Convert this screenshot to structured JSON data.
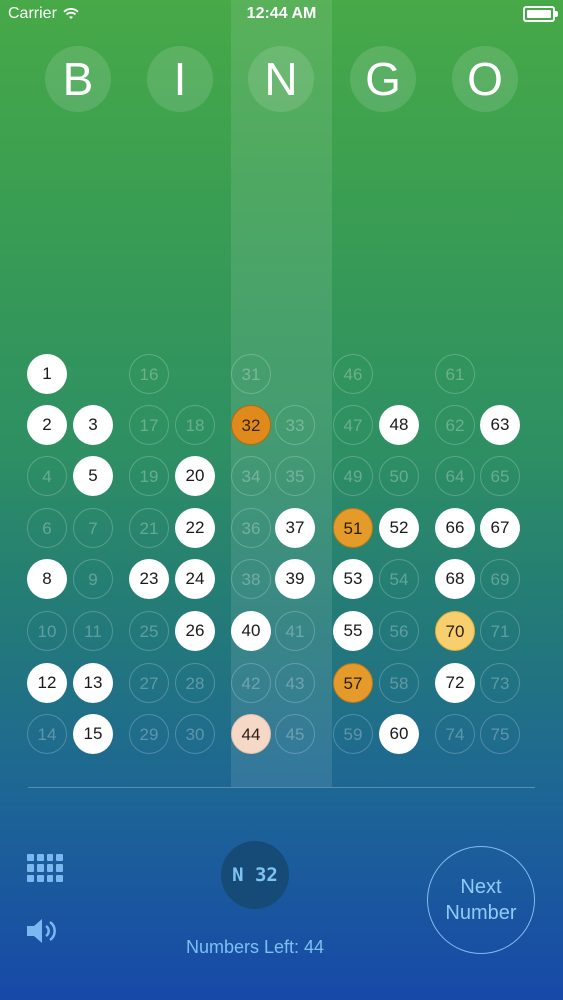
{
  "status_bar": {
    "carrier": "Carrier",
    "time": "12:44 AM",
    "battery_level": 1.0
  },
  "header": {
    "letters": [
      "B",
      "I",
      "N",
      "G",
      "O"
    ]
  },
  "board": {
    "highlight_column": "N",
    "called": [
      1,
      2,
      3,
      5,
      8,
      12,
      13,
      15,
      20,
      22,
      23,
      24,
      26,
      32,
      37,
      39,
      40,
      44,
      48,
      51,
      52,
      53,
      55,
      57,
      60,
      63,
      66,
      67,
      68,
      70,
      72
    ],
    "current": 32,
    "recent": [
      70,
      57,
      51,
      44
    ],
    "missing_cells": [
      1,
      16,
      31,
      46,
      61
    ]
  },
  "current_call": "N 32",
  "numbers_left_label": "Numbers Left: 44",
  "next_button": {
    "line1": "Next",
    "line2": "Number"
  },
  "icons": {
    "grid": "grid-icon",
    "sound": "speaker-icon"
  }
}
